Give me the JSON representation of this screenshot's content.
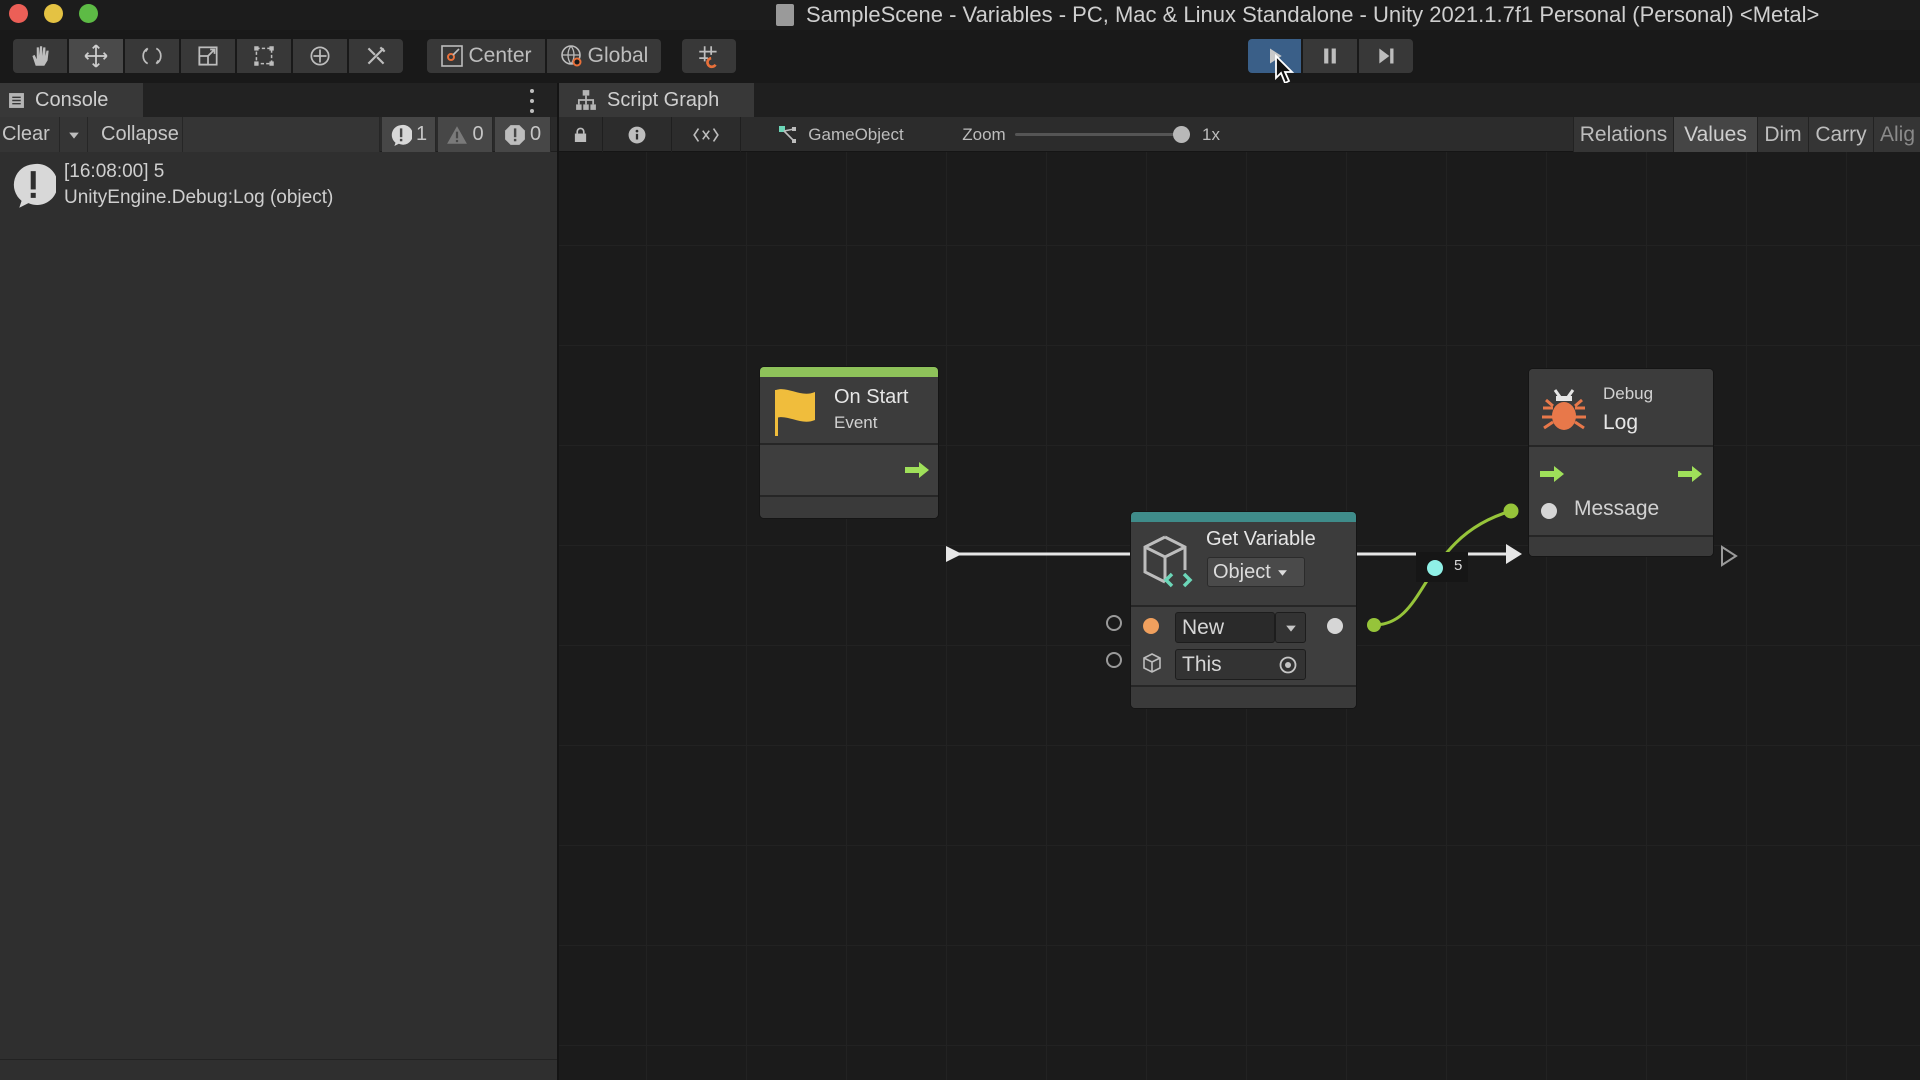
{
  "window": {
    "title": "SampleScene - Variables - PC, Mac & Linux Standalone - Unity 2021.1.7f1 Personal (Personal) <Metal>",
    "traffic_lights": {
      "close": "#ec5f57",
      "minimize": "#e4c243",
      "maximize": "#5dbb45"
    }
  },
  "toolbar": {
    "tools": [
      {
        "name": "hand-tool",
        "icon": "hand-icon",
        "active": false
      },
      {
        "name": "move-tool",
        "icon": "move-arrows-icon",
        "active": true
      },
      {
        "name": "rotate-tool",
        "icon": "rotate-icon",
        "active": false
      },
      {
        "name": "scale-tool",
        "icon": "scale-icon",
        "active": false
      },
      {
        "name": "rect-tool",
        "icon": "rect-transform-icon",
        "active": false
      },
      {
        "name": "transform-tool",
        "icon": "transform-icon",
        "active": false
      },
      {
        "name": "custom-tool",
        "icon": "tools-icon",
        "active": false
      }
    ],
    "pivot_label": "Center",
    "space_label": "Global",
    "snap_icon": "grid-snap-icon",
    "play_active": true
  },
  "console": {
    "tab_label": "Console",
    "clear_label": "Clear",
    "collapse_label": "Collapse",
    "counts": {
      "info": "1",
      "warning": "0",
      "error": "0"
    },
    "entries": [
      {
        "line1": "[16:08:00] 5",
        "line2": "UnityEngine.Debug:Log (object)"
      }
    ]
  },
  "graph": {
    "tab_label": "Script Graph",
    "breadcrumb": "GameObject",
    "zoom_label": "Zoom",
    "zoom_value_label": "1x",
    "zoom_fraction": 1.0,
    "toggles": [
      {
        "label": "Relations",
        "on": false
      },
      {
        "label": "Values",
        "on": true
      },
      {
        "label": "Dim",
        "on": false
      },
      {
        "label": "Carry",
        "on": false
      },
      {
        "label": "Alig",
        "on": false
      }
    ],
    "nodes": {
      "on_start": {
        "title": "On Start",
        "subtitle": "Event",
        "accent": "#8ec25a"
      },
      "get_variable": {
        "title": "Get Variable",
        "kind": "Object",
        "name_value": "New",
        "target_value": "This",
        "accent": "#3f8c8a"
      },
      "debug_log": {
        "title_top": "Debug",
        "title": "Log",
        "port_label": "Message"
      }
    },
    "edge_value": "5",
    "colors": {
      "flow_arrow": "#9fe05a",
      "value_edge": "#96c43a",
      "value_dot": "#8ff0e6"
    }
  }
}
